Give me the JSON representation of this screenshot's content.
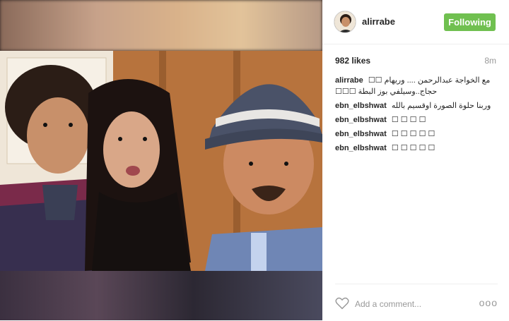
{
  "post": {
    "username": "alirrabe",
    "follow_label": "Following",
    "likes": "982 likes",
    "time": "8m",
    "comments": [
      {
        "user": "alirrabe",
        "text": "مع الخواجة عبدالرحمن .... وريهام ☐☐ حجاج..وسيلفي بوز البطة ☐☐☐"
      },
      {
        "user": "ebn_elbshwat",
        "text": "وربنا حلوة الصورة اوقسيم بالله"
      },
      {
        "user": "ebn_elbshwat",
        "text": "☐ ☐ ☐ ☐"
      },
      {
        "user": "ebn_elbshwat",
        "text": "☐ ☐ ☐ ☐ ☐"
      },
      {
        "user": "ebn_elbshwat",
        "text": "☐ ☐ ☐ ☐ ☐"
      }
    ],
    "add_comment_placeholder": "Add a comment...",
    "more_label": "ooo"
  },
  "icons": {
    "like": "heart-icon",
    "more": "more-options-icon"
  },
  "colors": {
    "follow_button": "#70c050"
  }
}
